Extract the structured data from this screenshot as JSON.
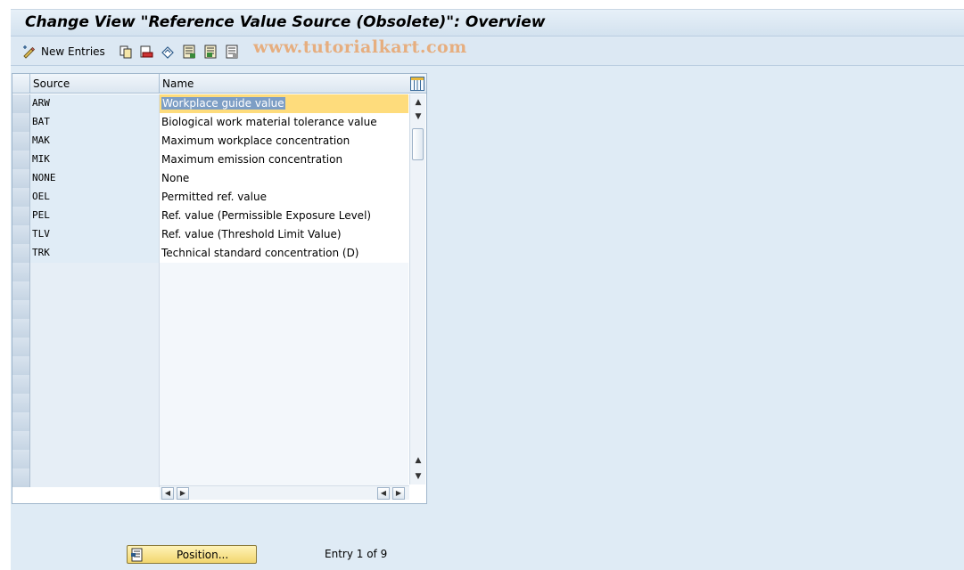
{
  "window": {
    "title": "Change View \"Reference Value Source (Obsolete)\": Overview"
  },
  "toolbar": {
    "new_entries_label": "New Entries",
    "watermark": "www.tutorialkart.com",
    "icons": [
      "edit-pencil-icon",
      "copy-icon",
      "delete-icon",
      "undo-icon",
      "select-all-icon",
      "select-block-icon",
      "deselect-all-icon"
    ]
  },
  "table": {
    "columns": [
      "Source",
      "Name"
    ],
    "rows": [
      {
        "source": "ARW",
        "name": "Workplace guide value"
      },
      {
        "source": "BAT",
        "name": "Biological work material tolerance value"
      },
      {
        "source": "MAK",
        "name": "Maximum workplace concentration"
      },
      {
        "source": "MIK",
        "name": "Maximum emission concentration"
      },
      {
        "source": "NONE",
        "name": "None"
      },
      {
        "source": "OEL",
        "name": "Permitted ref. value"
      },
      {
        "source": "PEL",
        "name": "Ref. value (Permissible Exposure Level)"
      },
      {
        "source": "TLV",
        "name": "Ref. value (Threshold Limit Value)"
      },
      {
        "source": "TRK",
        "name": "Technical standard concentration (D)"
      }
    ],
    "empty_rows": 12
  },
  "footer": {
    "position_button_label": "Position...",
    "entry_info": "Entry 1 of 9"
  },
  "colors": {
    "background": "#dfebf5",
    "selection_highlight": "#fedc7c",
    "selected_text_bg": "#7d9ec5",
    "watermark": "#e8a46b",
    "position_button": "#f2d66e"
  }
}
